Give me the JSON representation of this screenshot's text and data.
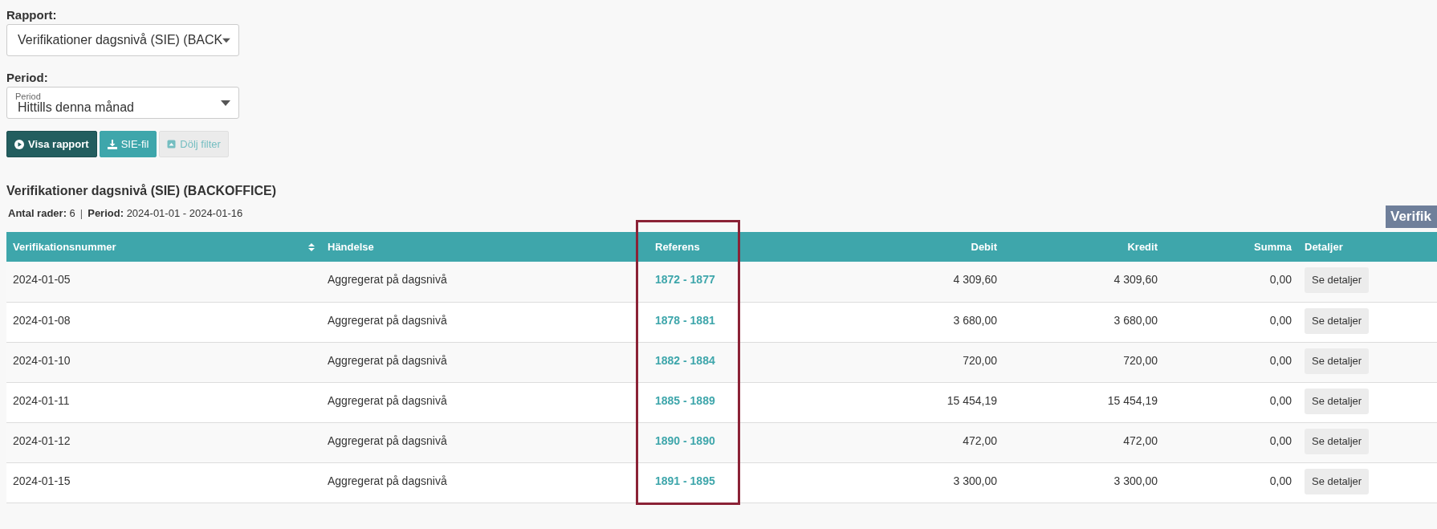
{
  "filters": {
    "report_label": "Rapport:",
    "report_value": "Verifikationer dagsnivå (SIE) (BACK",
    "period_label": "Period:",
    "period_floating_label": "Period",
    "period_value": "Hittills denna månad"
  },
  "buttons": [
    {
      "kind": "primary",
      "label": "Visa rapport",
      "disabled": false
    },
    {
      "kind": "secondary",
      "label": "SIE-fil",
      "disabled": false
    },
    {
      "kind": "light",
      "label": "Dölj filter",
      "disabled": true
    }
  ],
  "report": {
    "title": "Verifikationer dagsnivå (SIE) (BACKOFFICE)",
    "rows_label": "Antal rader:",
    "rows_value": "6",
    "separator": "|",
    "period_label": "Period:",
    "period_value": "2024-01-01 - 2024-01-16",
    "side_badge": "Verifik"
  },
  "table": {
    "columns": [
      {
        "label": "Verifikationsnummer",
        "sortable": true
      },
      {
        "label": "Händelse",
        "sortable": false
      },
      {
        "label": "Referens",
        "sortable": false
      },
      {
        "label": "Debit",
        "sortable": false
      },
      {
        "label": "Kredit",
        "sortable": false
      },
      {
        "label": "Summa",
        "sortable": false
      },
      {
        "label": "Detaljer",
        "sortable": false
      }
    ],
    "rows": [
      {
        "number": "2024-01-05",
        "event": "Aggregerat på dagsnivå",
        "reference": "1872 - 1877",
        "debit": "4 309,60",
        "credit": "4 309,60",
        "sum": "0,00",
        "action": "Se detaljer"
      },
      {
        "number": "2024-01-08",
        "event": "Aggregerat på dagsnivå",
        "reference": "1878 - 1881",
        "debit": "3 680,00",
        "credit": "3 680,00",
        "sum": "0,00",
        "action": "Se detaljer"
      },
      {
        "number": "2024-01-10",
        "event": "Aggregerat på dagsnivå",
        "reference": "1882 - 1884",
        "debit": "720,00",
        "credit": "720,00",
        "sum": "0,00",
        "action": "Se detaljer"
      },
      {
        "number": "2024-01-11",
        "event": "Aggregerat på dagsnivå",
        "reference": "1885 - 1889",
        "debit": "15 454,19",
        "credit": "15 454,19",
        "sum": "0,00",
        "action": "Se detaljer"
      },
      {
        "number": "2024-01-12",
        "event": "Aggregerat på dagsnivå",
        "reference": "1890 - 1890",
        "debit": "472,00",
        "credit": "472,00",
        "sum": "0,00",
        "action": "Se detaljer"
      },
      {
        "number": "2024-01-15",
        "event": "Aggregerat på dagsnivå",
        "reference": "1891 - 1895",
        "debit": "3 300,00",
        "credit": "3 300,00",
        "sum": "0,00",
        "action": "Se detaljer"
      }
    ]
  }
}
